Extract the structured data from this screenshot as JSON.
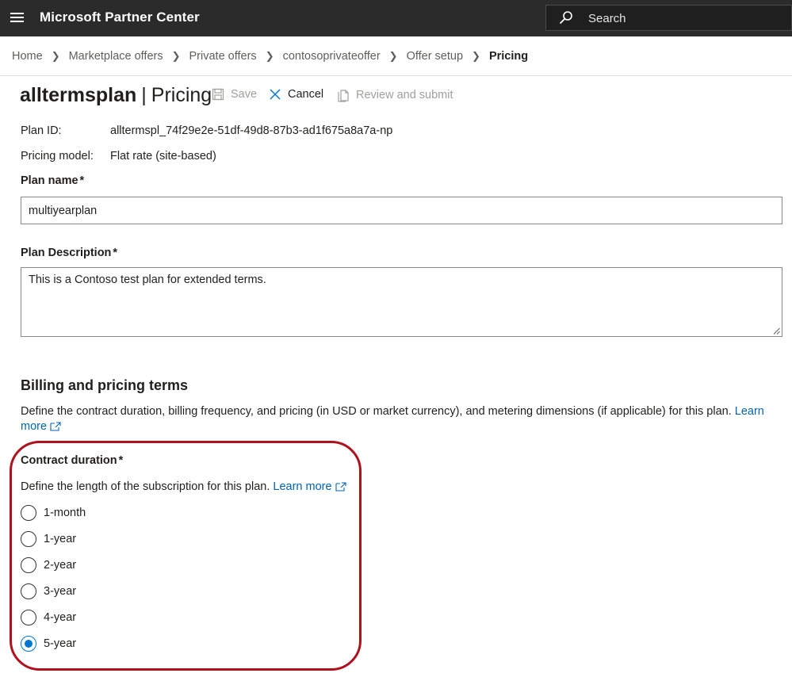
{
  "app": {
    "title": "Microsoft Partner Center",
    "search_placeholder": "Search"
  },
  "breadcrumb": [
    "Home",
    "Marketplace offers",
    "Private offers",
    "contosoprivateoffer",
    "Offer setup",
    "Pricing"
  ],
  "page": {
    "plan_name_title": "alltermsplan",
    "separator": "|",
    "section_title": "Pricing"
  },
  "commands": {
    "save": "Save",
    "cancel": "Cancel",
    "review": "Review and submit"
  },
  "info": {
    "plan_id_label": "Plan ID:",
    "plan_id_value": "alltermspl_74f29e2e-51df-49d8-87b3-ad1f675a8a7a-np",
    "pricing_model_label": "Pricing model:",
    "pricing_model_value": "Flat rate (site-based)"
  },
  "form": {
    "plan_name_label": "Plan name",
    "plan_name_value": "multiyearplan",
    "plan_description_label": "Plan Description",
    "plan_description_value": "This is a Contoso test plan for extended terms.",
    "required_mark": "*"
  },
  "billing": {
    "heading": "Billing and pricing terms",
    "description": "Define the contract duration, billing frequency, and pricing (in USD or market currency), and metering dimensions (if applicable) for this plan.",
    "learn_more_part1": "Learn",
    "learn_more_part2": "more"
  },
  "contract": {
    "label": "Contract duration",
    "description": "Define the length of the subscription for this plan.",
    "learn_more": "Learn more",
    "options": [
      "1-month",
      "1-year",
      "2-year",
      "3-year",
      "4-year",
      "5-year"
    ],
    "selected": "5-year"
  },
  "colors": {
    "topbar": "#2b2b2b",
    "link": "#0064b3",
    "radio_selected": "#0078d4",
    "highlight": "#b0121d"
  },
  "icons": {
    "menu": "hamburger-icon",
    "search": "search-icon",
    "save": "save-icon",
    "cancel": "close-icon",
    "review": "document-icon",
    "external": "external-link-icon",
    "breadcrumb_separator": "chevron-right-icon"
  }
}
